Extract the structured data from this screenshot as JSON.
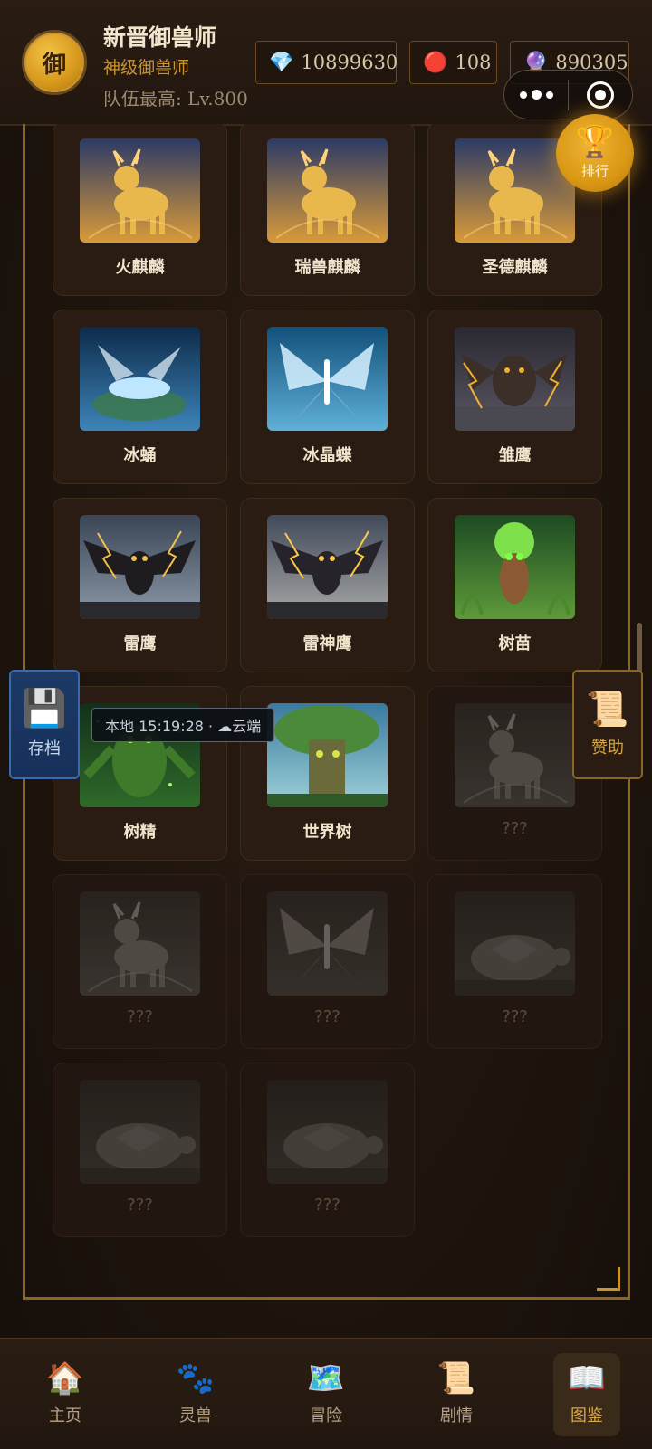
{
  "header": {
    "avatar_char": "御",
    "player_name": "新晋御兽师",
    "player_title": "神级御兽师",
    "team_level": "队伍最高: Lv.800",
    "currencies": [
      {
        "icon": "diamond-icon",
        "glyph": "💎",
        "value": "10899630"
      },
      {
        "icon": "red-orb-icon",
        "glyph": "🔴",
        "value": "108"
      },
      {
        "icon": "crystal-ball-icon",
        "glyph": "🔮",
        "value": "890305"
      }
    ]
  },
  "rank_button": {
    "glyph": "🏆",
    "label": "排行"
  },
  "cards": [
    {
      "name": "",
      "locked": false,
      "partial": true,
      "art": "none"
    },
    {
      "name": "",
      "locked": false,
      "partial": true,
      "art": "none"
    },
    {
      "name": "",
      "locked": false,
      "partial": true,
      "art": "none"
    },
    {
      "name": "火麒麟",
      "locked": false,
      "art": "qilin"
    },
    {
      "name": "瑞兽麒麟",
      "locked": false,
      "art": "qilin"
    },
    {
      "name": "圣德麒麟",
      "locked": false,
      "art": "qilin"
    },
    {
      "name": "冰蛹",
      "locked": false,
      "art": "ice-larva"
    },
    {
      "name": "冰晶蝶",
      "locked": false,
      "art": "ice-butterfly"
    },
    {
      "name": "雏鹰",
      "locked": false,
      "art": "eaglet"
    },
    {
      "name": "雷鹰",
      "locked": false,
      "art": "thunder-eagle"
    },
    {
      "name": "雷神鹰",
      "locked": false,
      "art": "thunder-god-eagle"
    },
    {
      "name": "树苗",
      "locked": false,
      "art": "sapling"
    },
    {
      "name": "树精",
      "locked": false,
      "art": "treant"
    },
    {
      "name": "世界树",
      "locked": false,
      "art": "world-tree"
    },
    {
      "name": "???",
      "locked": true,
      "art": "fox"
    },
    {
      "name": "???",
      "locked": true,
      "art": "fox"
    },
    {
      "name": "???",
      "locked": true,
      "art": "nine-tail"
    },
    {
      "name": "???",
      "locked": true,
      "art": "turtle"
    },
    {
      "name": "???",
      "locked": true,
      "art": "turtle"
    },
    {
      "name": "???",
      "locked": true,
      "art": "serpent-turtle"
    }
  ],
  "save_button": {
    "glyph": "💾",
    "label": "存档"
  },
  "save_tooltip": "本地 15:19:28 · ☁云端",
  "sponsor_button": {
    "glyph": "📜",
    "label": "赞助"
  },
  "nav": [
    {
      "icon": "home-icon",
      "glyph": "🏠",
      "label": "主页",
      "active": false
    },
    {
      "icon": "paw-icon",
      "glyph": "🐾",
      "label": "灵兽",
      "active": false
    },
    {
      "icon": "map-icon",
      "glyph": "🗺️",
      "label": "冒险",
      "active": false
    },
    {
      "icon": "scroll-icon",
      "glyph": "📜",
      "label": "剧情",
      "active": false
    },
    {
      "icon": "book-icon",
      "glyph": "📖",
      "label": "图鉴",
      "active": true
    }
  ],
  "colors": {
    "accent": "#c9942f",
    "gold": "#d99714",
    "save_blue": "#1d3a66"
  }
}
